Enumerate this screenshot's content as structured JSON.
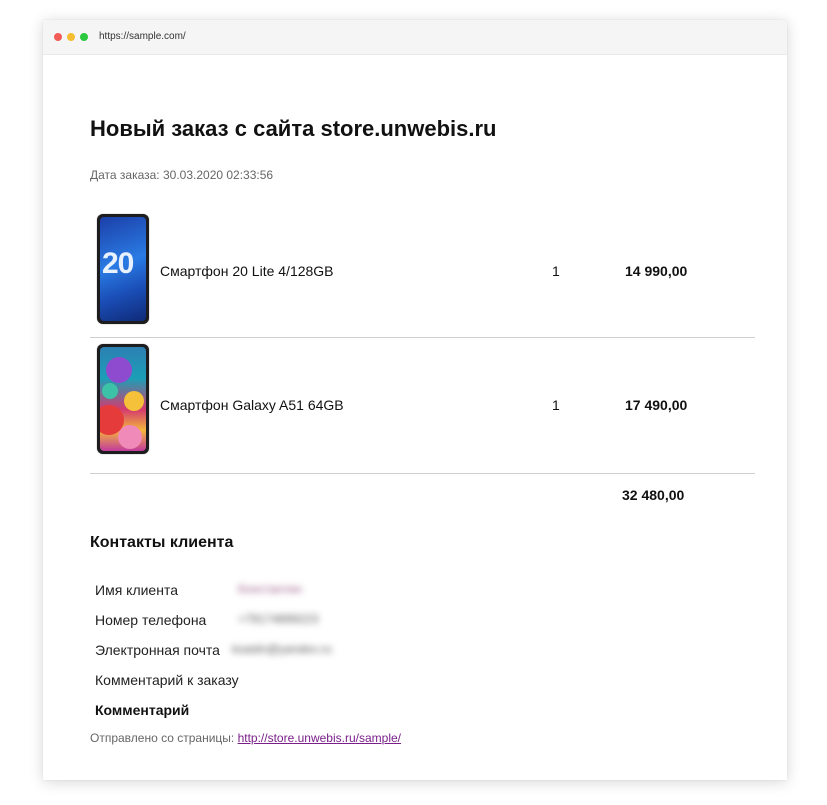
{
  "browser": {
    "url": "https://sample.com/"
  },
  "order": {
    "title": "Новый заказ с сайта store.unwebis.ru",
    "date": "Дата заказа: 30.03.2020 02:33:56",
    "items": [
      {
        "name": "Смартфон 20 Lite 4/128GB",
        "quantity": "1",
        "price": "14 990,00",
        "image_icon": "honor-20-lite-phone-image",
        "screen_text": "20"
      },
      {
        "name": "Смартфон Galaxy A51 64GB",
        "quantity": "1",
        "price": "17 490,00",
        "image_icon": "galaxy-a51-phone-image"
      }
    ],
    "total": "32 480,00"
  },
  "contacts": {
    "title": "Контакты клиента",
    "rows": [
      {
        "label": "Имя клиента",
        "value": "Константин"
      },
      {
        "label": "Номер телефона",
        "value": "+79174899223"
      },
      {
        "label": "Электронная почта",
        "value": "ksaidn@yandex.ru"
      },
      {
        "label": "Комментарий к заказу",
        "value": ""
      },
      {
        "label": "Комментарий",
        "value": ""
      }
    ]
  },
  "footer": {
    "prefix": "Отправлено со страницы: ",
    "link_text": "http://store.unwebis.ru/sample/"
  }
}
